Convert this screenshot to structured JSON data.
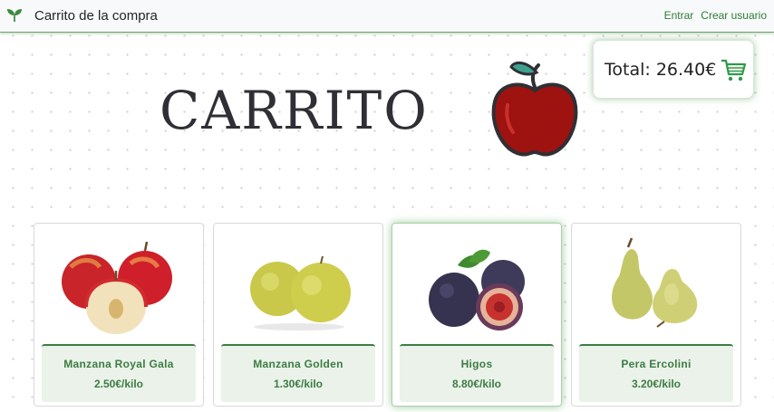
{
  "navbar": {
    "logo_icon": "leaf-sprout-icon",
    "title": "Carrito de la compra",
    "login_label": "Entrar",
    "register_label": "Crear usuario"
  },
  "cart": {
    "total_text": "Total: 26.40€",
    "icon": "shopping-cart-icon"
  },
  "hero": {
    "title": "CARRITO",
    "image": "red-apple-illustration"
  },
  "colors": {
    "accent_green": "#3d7c42",
    "apple_red": "#9e120f",
    "leaf_teal": "#3fa08e"
  },
  "products": [
    {
      "name": "Manzana Royal Gala",
      "price": "2.50€/kilo",
      "image": "royal-gala-apples"
    },
    {
      "name": "Manzana Golden",
      "price": "1.30€/kilo",
      "image": "golden-apples"
    },
    {
      "name": "Higos",
      "price": "8.80€/kilo",
      "image": "figs",
      "selected": true
    },
    {
      "name": "Pera Ercolini",
      "price": "3.20€/kilo",
      "image": "ercolini-pears"
    }
  ]
}
